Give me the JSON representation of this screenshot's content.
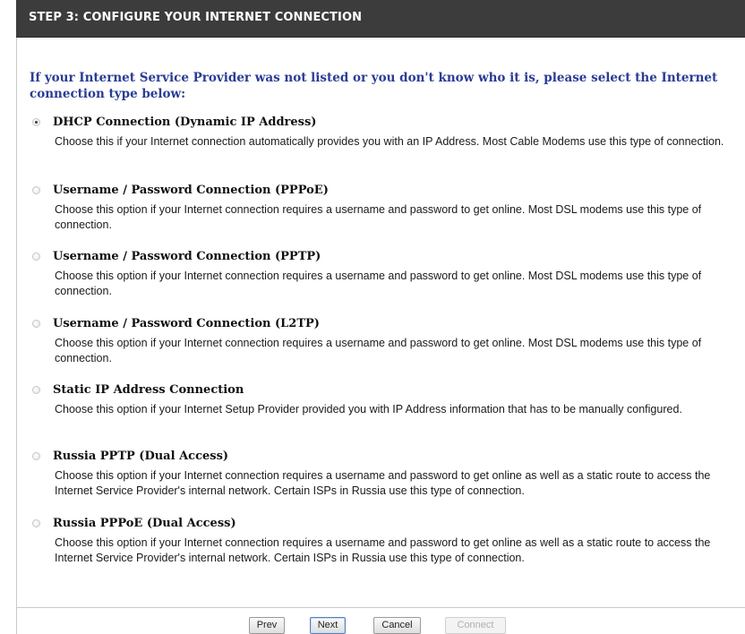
{
  "header": {
    "title": "STEP 3: CONFIGURE YOUR INTERNET CONNECTION"
  },
  "intro": "If your Internet Service Provider was not listed or you don't know who it is, please select the Internet connection type below:",
  "options": [
    {
      "label": "DHCP Connection (Dynamic IP Address)",
      "checked": true,
      "description": "Choose this if your Internet connection automatically provides you with an IP Address. Most Cable Modems use this type of connection."
    },
    {
      "label": "Username / Password Connection (PPPoE)",
      "checked": false,
      "description": "Choose this option if your Internet connection requires a username and password to get online. Most DSL modems use this type of connection."
    },
    {
      "label": "Username / Password Connection (PPTP)",
      "checked": false,
      "description": "Choose this option if your Internet connection requires a username and password to get online. Most DSL modems use this type of connection."
    },
    {
      "label": "Username / Password Connection (L2TP)",
      "checked": false,
      "description": "Choose this option if your Internet connection requires a username and password to get online. Most DSL modems use this type of connection."
    },
    {
      "label": "Static IP Address Connection",
      "checked": false,
      "description": "Choose this option if your Internet Setup Provider provided you with IP Address information that has to be manually configured."
    },
    {
      "label": "Russia PPTP (Dual Access)",
      "checked": false,
      "description": "Choose this option if your Internet connection requires a username and password to get online as well as a static route to access the Internet Service Provider's internal network. Certain ISPs in Russia use this type of connection."
    },
    {
      "label": "Russia PPPoE (Dual Access)",
      "checked": false,
      "description": "Choose this option if your Internet connection requires a username and password to get online as well as a static route to access the Internet Service Provider's internal network. Certain ISPs in Russia use this type of connection."
    }
  ],
  "buttons": {
    "prev": "Prev",
    "next": "Next",
    "cancel": "Cancel",
    "connect": "Connect"
  }
}
